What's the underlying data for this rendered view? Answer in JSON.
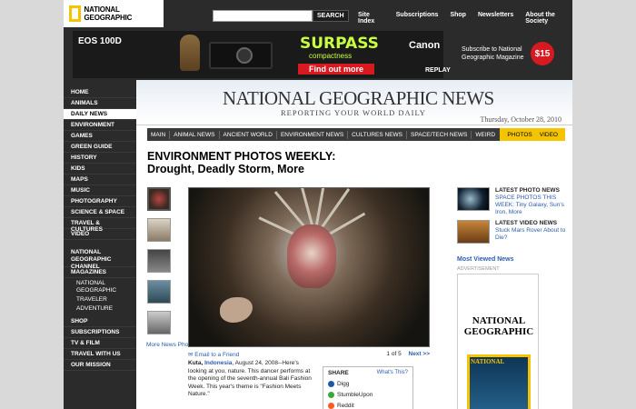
{
  "header": {
    "logo_text": "NATIONAL GEOGRAPHIC",
    "search_placeholder": "",
    "search_button": "SEARCH",
    "nav": [
      "Site Index",
      "Subscriptions",
      "Shop",
      "Newsletters",
      "About the Society"
    ]
  },
  "ad": {
    "camera": "EOS 100D",
    "headline": "SURPASS",
    "subline": "compactness",
    "cta": "Find out more",
    "brand": "Canon",
    "replay": "REPLAY"
  },
  "promo": {
    "text": "Subscribe to National Geographic Magazine",
    "price": "$15"
  },
  "leftnav": [
    {
      "label": "HOME",
      "active": false
    },
    {
      "label": "ANIMALS",
      "active": false
    },
    {
      "label": "DAILY NEWS",
      "active": true
    },
    {
      "label": "ENVIRONMENT",
      "active": false
    },
    {
      "label": "GAMES",
      "active": false
    },
    {
      "label": "GREEN GUIDE",
      "active": false
    },
    {
      "label": "HISTORY",
      "active": false
    },
    {
      "label": "KIDS",
      "active": false
    },
    {
      "label": "MAPS",
      "active": false
    },
    {
      "label": "MUSIC",
      "active": false
    },
    {
      "label": "PHOTOGRAPHY",
      "active": false
    },
    {
      "label": "SCIENCE & SPACE",
      "active": false
    },
    {
      "label": "TRAVEL & CULTURES",
      "active": false
    },
    {
      "label": "VIDEO",
      "active": false
    }
  ],
  "leftnav2": {
    "channel": "NATIONAL GEOGRAPHIC CHANNEL",
    "magazines": "MAGAZINES",
    "mag_sub": [
      "NATIONAL GEOGRAPHIC",
      "TRAVELER",
      "ADVENTURE"
    ],
    "bottom": [
      "SHOP",
      "SUBSCRIPTIONS",
      "TV & FILM",
      "TRAVEL WITH US",
      "OUR MISSION"
    ]
  },
  "masthead": {
    "title": "NATIONAL GEOGRAPHIC NEWS",
    "subtitle": "REPORTING YOUR WORLD DAILY",
    "date": "Thursday, October 28, 2010"
  },
  "secnav": [
    "MAIN",
    "ANIMAL NEWS",
    "ANCIENT WORLD",
    "ENVIRONMENT NEWS",
    "CULTURES NEWS",
    "SPACE/TECH NEWS",
    "WEIRD"
  ],
  "secnav_right": [
    "PHOTOS",
    "VIDEO"
  ],
  "article": {
    "title_line1": "ENVIRONMENT PHOTOS WEEKLY:",
    "title_line2": "Drought, Deadly Storm, More",
    "more_news": "More News Photos",
    "email": "Email to a Friend",
    "page_count": "1 of 5",
    "next": "Next >>",
    "caption_place": "Kuta,",
    "caption_country": "Indonesia",
    "caption_text": ", August 24, 2008--Here's looking at you, nature. This dancer performs at the opening of the seventh-annual Bali Fashion Week. This year's theme is \"Fashion Meets Nature.\""
  },
  "share": {
    "heading": "SHARE",
    "whats_this": "What's This?",
    "items": [
      "Digg",
      "StumbleUpon",
      "Reddit"
    ]
  },
  "right": {
    "latest_photo_label": "LATEST PHOTO NEWS",
    "latest_photo_link": "SPACE PHOTOS THIS WEEK: Tiny Galaxy, Sun's Iron, More",
    "latest_video_label": "LATEST VIDEO NEWS",
    "latest_video_link": "Stuck Mars Rover About to Die?",
    "most_viewed": "Most Viewed News",
    "advert": "ADVERTISEMENT",
    "mag_title": "NATIONAL GEOGRAPHIC",
    "cover_title": "NATIONAL"
  },
  "colors": {
    "yellow": "#f5c400",
    "link": "#2a5db0",
    "dark": "#2b2b2b"
  }
}
